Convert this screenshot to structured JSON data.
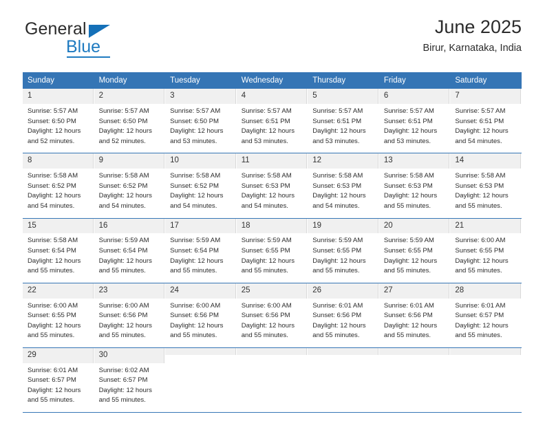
{
  "brand": {
    "name_top": "General",
    "name_bottom": "Blue",
    "accent_color": "#1e7ac0"
  },
  "header": {
    "title": "June 2025",
    "subtitle": "Birur, Karnataka, India"
  },
  "theme": {
    "header_blue": "#3575b5",
    "daynum_band": "#f0f0f0",
    "text": "#2b2b2b"
  },
  "calendar": {
    "weekday_headers": [
      "Sunday",
      "Monday",
      "Tuesday",
      "Wednesday",
      "Thursday",
      "Friday",
      "Saturday"
    ],
    "weeks": [
      [
        {
          "day": "1",
          "sunrise": "Sunrise: 5:57 AM",
          "sunset": "Sunset: 6:50 PM",
          "daylight": "Daylight: 12 hours and 52 minutes."
        },
        {
          "day": "2",
          "sunrise": "Sunrise: 5:57 AM",
          "sunset": "Sunset: 6:50 PM",
          "daylight": "Daylight: 12 hours and 52 minutes."
        },
        {
          "day": "3",
          "sunrise": "Sunrise: 5:57 AM",
          "sunset": "Sunset: 6:50 PM",
          "daylight": "Daylight: 12 hours and 53 minutes."
        },
        {
          "day": "4",
          "sunrise": "Sunrise: 5:57 AM",
          "sunset": "Sunset: 6:51 PM",
          "daylight": "Daylight: 12 hours and 53 minutes."
        },
        {
          "day": "5",
          "sunrise": "Sunrise: 5:57 AM",
          "sunset": "Sunset: 6:51 PM",
          "daylight": "Daylight: 12 hours and 53 minutes."
        },
        {
          "day": "6",
          "sunrise": "Sunrise: 5:57 AM",
          "sunset": "Sunset: 6:51 PM",
          "daylight": "Daylight: 12 hours and 53 minutes."
        },
        {
          "day": "7",
          "sunrise": "Sunrise: 5:57 AM",
          "sunset": "Sunset: 6:51 PM",
          "daylight": "Daylight: 12 hours and 54 minutes."
        }
      ],
      [
        {
          "day": "8",
          "sunrise": "Sunrise: 5:58 AM",
          "sunset": "Sunset: 6:52 PM",
          "daylight": "Daylight: 12 hours and 54 minutes."
        },
        {
          "day": "9",
          "sunrise": "Sunrise: 5:58 AM",
          "sunset": "Sunset: 6:52 PM",
          "daylight": "Daylight: 12 hours and 54 minutes."
        },
        {
          "day": "10",
          "sunrise": "Sunrise: 5:58 AM",
          "sunset": "Sunset: 6:52 PM",
          "daylight": "Daylight: 12 hours and 54 minutes."
        },
        {
          "day": "11",
          "sunrise": "Sunrise: 5:58 AM",
          "sunset": "Sunset: 6:53 PM",
          "daylight": "Daylight: 12 hours and 54 minutes."
        },
        {
          "day": "12",
          "sunrise": "Sunrise: 5:58 AM",
          "sunset": "Sunset: 6:53 PM",
          "daylight": "Daylight: 12 hours and 54 minutes."
        },
        {
          "day": "13",
          "sunrise": "Sunrise: 5:58 AM",
          "sunset": "Sunset: 6:53 PM",
          "daylight": "Daylight: 12 hours and 55 minutes."
        },
        {
          "day": "14",
          "sunrise": "Sunrise: 5:58 AM",
          "sunset": "Sunset: 6:53 PM",
          "daylight": "Daylight: 12 hours and 55 minutes."
        }
      ],
      [
        {
          "day": "15",
          "sunrise": "Sunrise: 5:58 AM",
          "sunset": "Sunset: 6:54 PM",
          "daylight": "Daylight: 12 hours and 55 minutes."
        },
        {
          "day": "16",
          "sunrise": "Sunrise: 5:59 AM",
          "sunset": "Sunset: 6:54 PM",
          "daylight": "Daylight: 12 hours and 55 minutes."
        },
        {
          "day": "17",
          "sunrise": "Sunrise: 5:59 AM",
          "sunset": "Sunset: 6:54 PM",
          "daylight": "Daylight: 12 hours and 55 minutes."
        },
        {
          "day": "18",
          "sunrise": "Sunrise: 5:59 AM",
          "sunset": "Sunset: 6:55 PM",
          "daylight": "Daylight: 12 hours and 55 minutes."
        },
        {
          "day": "19",
          "sunrise": "Sunrise: 5:59 AM",
          "sunset": "Sunset: 6:55 PM",
          "daylight": "Daylight: 12 hours and 55 minutes."
        },
        {
          "day": "20",
          "sunrise": "Sunrise: 5:59 AM",
          "sunset": "Sunset: 6:55 PM",
          "daylight": "Daylight: 12 hours and 55 minutes."
        },
        {
          "day": "21",
          "sunrise": "Sunrise: 6:00 AM",
          "sunset": "Sunset: 6:55 PM",
          "daylight": "Daylight: 12 hours and 55 minutes."
        }
      ],
      [
        {
          "day": "22",
          "sunrise": "Sunrise: 6:00 AM",
          "sunset": "Sunset: 6:55 PM",
          "daylight": "Daylight: 12 hours and 55 minutes."
        },
        {
          "day": "23",
          "sunrise": "Sunrise: 6:00 AM",
          "sunset": "Sunset: 6:56 PM",
          "daylight": "Daylight: 12 hours and 55 minutes."
        },
        {
          "day": "24",
          "sunrise": "Sunrise: 6:00 AM",
          "sunset": "Sunset: 6:56 PM",
          "daylight": "Daylight: 12 hours and 55 minutes."
        },
        {
          "day": "25",
          "sunrise": "Sunrise: 6:00 AM",
          "sunset": "Sunset: 6:56 PM",
          "daylight": "Daylight: 12 hours and 55 minutes."
        },
        {
          "day": "26",
          "sunrise": "Sunrise: 6:01 AM",
          "sunset": "Sunset: 6:56 PM",
          "daylight": "Daylight: 12 hours and 55 minutes."
        },
        {
          "day": "27",
          "sunrise": "Sunrise: 6:01 AM",
          "sunset": "Sunset: 6:56 PM",
          "daylight": "Daylight: 12 hours and 55 minutes."
        },
        {
          "day": "28",
          "sunrise": "Sunrise: 6:01 AM",
          "sunset": "Sunset: 6:57 PM",
          "daylight": "Daylight: 12 hours and 55 minutes."
        }
      ],
      [
        {
          "day": "29",
          "sunrise": "Sunrise: 6:01 AM",
          "sunset": "Sunset: 6:57 PM",
          "daylight": "Daylight: 12 hours and 55 minutes."
        },
        {
          "day": "30",
          "sunrise": "Sunrise: 6:02 AM",
          "sunset": "Sunset: 6:57 PM",
          "daylight": "Daylight: 12 hours and 55 minutes."
        },
        {
          "day": "",
          "sunrise": "",
          "sunset": "",
          "daylight": ""
        },
        {
          "day": "",
          "sunrise": "",
          "sunset": "",
          "daylight": ""
        },
        {
          "day": "",
          "sunrise": "",
          "sunset": "",
          "daylight": ""
        },
        {
          "day": "",
          "sunrise": "",
          "sunset": "",
          "daylight": ""
        },
        {
          "day": "",
          "sunrise": "",
          "sunset": "",
          "daylight": ""
        }
      ]
    ]
  }
}
